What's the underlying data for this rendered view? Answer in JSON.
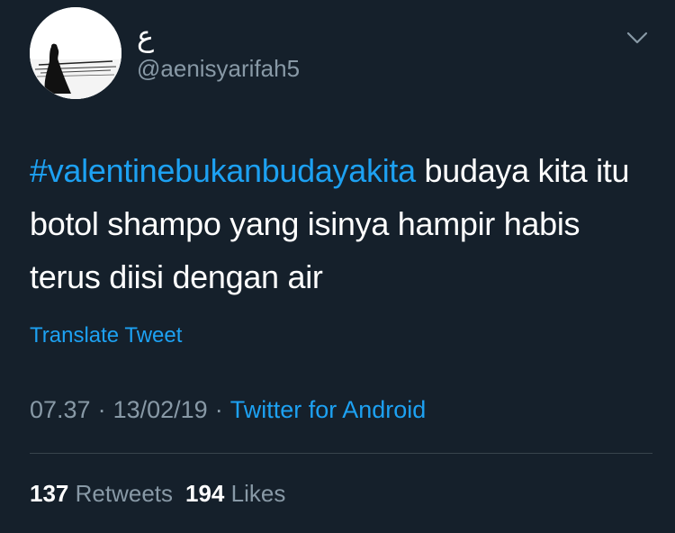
{
  "user": {
    "display_name": "ع",
    "handle": "@aenisyarifah5",
    "avatar_icon": "profile-avatar"
  },
  "tweet": {
    "hashtag": "#valentinebukanbudayakita",
    "text_rest": " budaya kita itu botol shampo yang isinya hampir habis terus diisi dengan air",
    "translate_label": "Translate Tweet",
    "time": "07.37",
    "date": "13/02/19",
    "separator": "·",
    "source": "Twitter for Android"
  },
  "stats": {
    "retweets_count": "137",
    "retweets_label": "Retweets",
    "likes_count": "194",
    "likes_label": "Likes"
  },
  "icons": {
    "menu": "chevron-down-icon"
  },
  "colors": {
    "background": "#15202b",
    "accent": "#1da1f2",
    "secondary_text": "#8899a6",
    "primary_text": "#ffffff",
    "divider": "#38444d"
  }
}
